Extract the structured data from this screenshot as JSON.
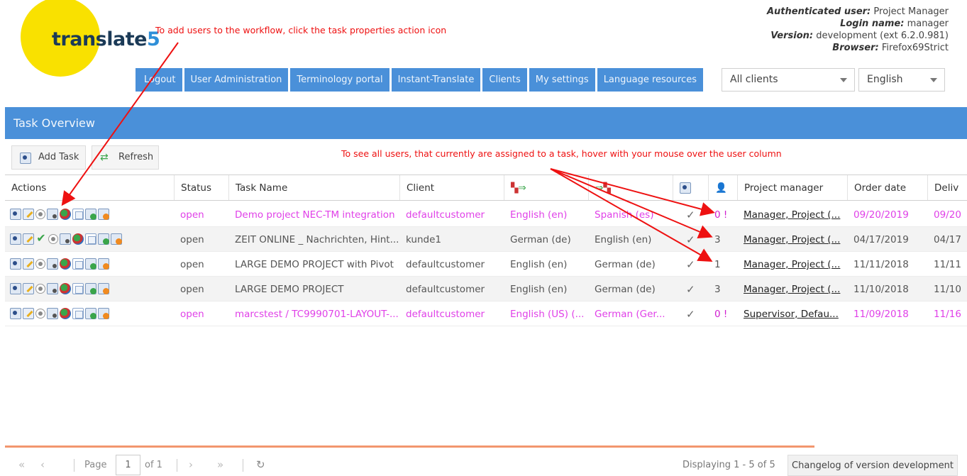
{
  "logo": {
    "text_main": "translate",
    "text_num": "5"
  },
  "annotations": {
    "top": "To add users to the workflow, click the task properties action icon",
    "middle": "To see all users, that currently are assigned to a task, hover with your mouse over the user column"
  },
  "user_info": {
    "auth_label": "Authenticated user:",
    "auth_value": "Project Manager",
    "login_label": "Login name:",
    "login_value": "manager",
    "version_label": "Version:",
    "version_value": "development (ext 6.2.0.981)",
    "browser_label": "Browser:",
    "browser_value": "Firefox69Strict"
  },
  "nav": {
    "logout": "Logout",
    "user_admin": "User Administration",
    "terminology": "Terminology portal",
    "instant": "Instant-Translate",
    "clients": "Clients",
    "settings": "My settings",
    "lang_resources": "Language resources",
    "clients_combo": "All clients",
    "language_combo": "English"
  },
  "panel": {
    "title": "Task Overview",
    "add_task": "Add Task",
    "refresh": "Refresh"
  },
  "columns": {
    "actions": "Actions",
    "status": "Status",
    "task_name": "Task Name",
    "client": "Client",
    "project_manager": "Project manager",
    "order_date": "Order date",
    "delivery": "Deliv"
  },
  "rows": [
    {
      "status": "open",
      "task": "Demo project NEC-TM integration",
      "client": "defaultcustomer",
      "source": "English (en)",
      "target": "Spanish (es)",
      "users": "0 !",
      "pm": "Manager, Project (...",
      "order": "09/20/2019",
      "delivery": "09/20",
      "style": "pink",
      "extra_ok": false
    },
    {
      "status": "open",
      "task": "ZEIT ONLINE _ Nachrichten, Hint...",
      "client": "kunde1",
      "source": "German (de)",
      "target": "English (en)",
      "users": "3",
      "pm": "Manager, Project (...",
      "order": "04/17/2019",
      "delivery": "04/17",
      "style": "normal",
      "extra_ok": true
    },
    {
      "status": "open",
      "task": "LARGE DEMO PROJECT with Pivot",
      "client": "defaultcustomer",
      "source": "English (en)",
      "target": "German (de)",
      "users": "1",
      "pm": "Manager, Project (...",
      "order": "11/11/2018",
      "delivery": "11/11",
      "style": "normal",
      "extra_ok": false
    },
    {
      "status": "open",
      "task": "LARGE DEMO PROJECT",
      "client": "defaultcustomer",
      "source": "English (en)",
      "target": "German (de)",
      "users": "3",
      "pm": "Manager, Project (...",
      "order": "11/10/2018",
      "delivery": "11/10",
      "style": "normal",
      "extra_ok": false
    },
    {
      "status": "open",
      "task": "marcstest / TC9990701-LAYOUT-...",
      "client": "defaultcustomer",
      "source": "English (US) (...",
      "target": "German (Ger...",
      "users": "0 !",
      "pm": "Supervisor, Defau...",
      "order": "11/09/2018",
      "delivery": "11/16",
      "style": "pink",
      "extra_ok": false
    }
  ],
  "pager": {
    "page_label": "Page",
    "page_value": "1",
    "of_label": "of 1",
    "displaying": "Displaying 1 - 5 of 5",
    "changelog": "Changelog of version development"
  },
  "colors": {
    "accent": "#4a90d9",
    "logo_yellow": "#f9e100",
    "annotation": "#ee1111",
    "pink_row": "#e040e8"
  },
  "icons": [
    "open-doc-icon",
    "edit-icon",
    "ok-icon",
    "radio-icon",
    "task-properties-icon",
    "language-icon",
    "copy-icon",
    "export-icon",
    "delete-icon"
  ]
}
